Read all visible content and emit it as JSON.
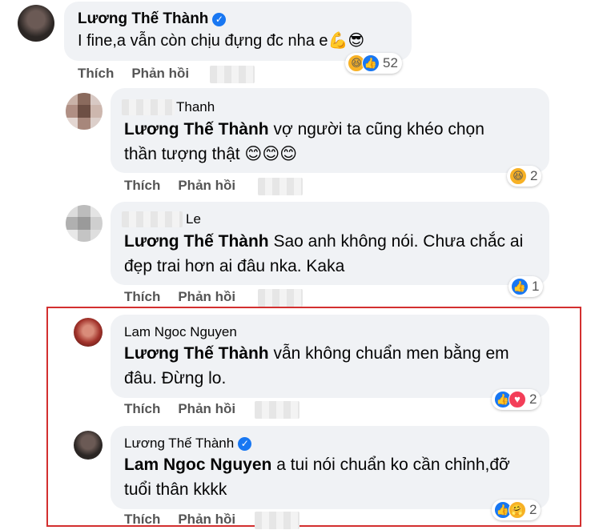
{
  "comments": [
    {
      "name": "Lương Thế Thành",
      "verified": true,
      "text": "I fine,a vẫn còn chịu đựng đc nha e💪😎",
      "react_count": "52",
      "like": "Thích",
      "reply": "Phản hồi"
    },
    {
      "name": "Thanh",
      "tag": "Lương Thế Thành",
      "text_line1": " vợ người ta cũng khéo chọn",
      "text_line2": "thần tượng thật 😊😊😊",
      "react_count": "2",
      "like": "Thích",
      "reply": "Phản hồi"
    },
    {
      "name": "Le",
      "tag": "Lương Thế Thành",
      "text_line1": " Sao anh không nói. Chưa chắc ai",
      "text_line2": "đẹp trai hơn ai đâu nka. Kaka",
      "react_count": "1",
      "like": "Thích",
      "reply": "Phản hồi"
    },
    {
      "name": "Lam Ngoc Nguyen",
      "tag": "Lương Thế Thành",
      "text_line1": " vẫn không chuẩn men bằng em",
      "text_line2": "đâu. Đừng lo.",
      "react_count": "2",
      "like": "Thích",
      "reply": "Phản hồi"
    },
    {
      "name": "Lương Thế Thành",
      "verified": true,
      "tag": "Lam Ngoc Nguyen",
      "text_line1": " a tui nói chuẩn ko cần chỉnh,đỡ",
      "text_line2": "tuổi thân kkkk",
      "react_count": "2",
      "like": "Thích",
      "reply": "Phản hồi"
    }
  ],
  "colors": {
    "bubble": "#f0f2f5",
    "highlight_border": "#d32f2f",
    "like_blue": "#1877f2"
  }
}
